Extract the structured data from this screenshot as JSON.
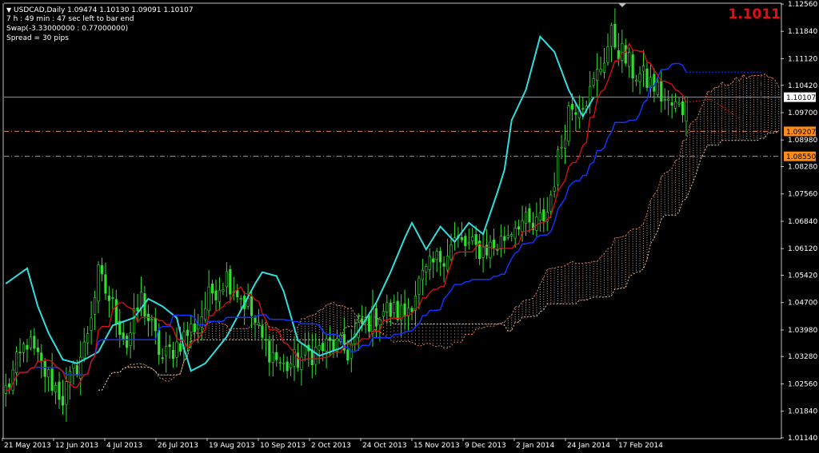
{
  "header": {
    "symbol_line": "USDCAD,Daily  1.09474 1.10130 1.09091 1.10107",
    "timer": "7 h : 49 min : 47 sec left to bar end",
    "swap": "Swap(-3.33000000 : 0.77000000)",
    "spread": "Spread = 30 pips",
    "big_price": "1.1011"
  },
  "colors": {
    "background": "#000000",
    "candles": "#33dd33",
    "tenkan": "#dd1111",
    "kijun": "#1133ff",
    "chikou": "#33dddd",
    "cloud": "#f2c4a8",
    "bid_line": "#8a93c8",
    "level_lines": "#e0825a",
    "level_label_bg": "#ff8c1a"
  },
  "chart_data": {
    "type": "candlestick",
    "symbol": "USDCAD",
    "timeframe": "Daily",
    "ohlc_last": {
      "open": 1.09474,
      "high": 1.1013,
      "low": 1.09091,
      "close": 1.10107
    },
    "ylim": [
      1.0114,
      1.1256
    ],
    "y_ticks": [
      "1.12560",
      "1.11840",
      "1.11120",
      "1.10420",
      "1.09700",
      "1.08980",
      "1.08280",
      "1.07560",
      "1.06840",
      "1.06120",
      "1.05420",
      "1.04700",
      "1.03980",
      "1.03280",
      "1.02560",
      "1.01840",
      "1.01140"
    ],
    "x_ticks": [
      "21 May 2013",
      "12 Jun 2013",
      "4 Jul 2013",
      "26 Jul 2013",
      "19 Aug 2013",
      "10 Sep 2013",
      "2 Oct 2013",
      "24 Oct 2013",
      "15 Nov 2013",
      "9 Dec 2013",
      "2 Jan 2014",
      "24 Jan 2014",
      "17 Feb 2014"
    ],
    "bars": 192,
    "shift_bars": 26,
    "bid_price": "1.10107",
    "levels": [
      "1.09207",
      "1.08550"
    ],
    "close_anchors": [
      [
        0,
        1.024
      ],
      [
        6,
        1.037
      ],
      [
        10,
        1.03
      ],
      [
        16,
        1.022
      ],
      [
        22,
        1.035
      ],
      [
        26,
        1.054
      ],
      [
        30,
        1.046
      ],
      [
        34,
        1.036
      ],
      [
        38,
        1.048
      ],
      [
        44,
        1.032
      ],
      [
        48,
        1.036
      ],
      [
        54,
        1.042
      ],
      [
        58,
        1.05
      ],
      [
        62,
        1.054
      ],
      [
        68,
        1.046
      ],
      [
        72,
        1.037
      ],
      [
        78,
        1.03
      ],
      [
        86,
        1.034
      ],
      [
        92,
        1.036
      ],
      [
        96,
        1.034
      ],
      [
        100,
        1.041
      ],
      [
        106,
        1.045
      ],
      [
        112,
        1.044
      ],
      [
        116,
        1.052
      ],
      [
        120,
        1.057
      ],
      [
        126,
        1.063
      ],
      [
        132,
        1.061
      ],
      [
        138,
        1.062
      ],
      [
        144,
        1.069
      ],
      [
        148,
        1.066
      ],
      [
        152,
        1.071
      ],
      [
        158,
        1.098
      ],
      [
        164,
        1.102
      ],
      [
        170,
        1.117
      ],
      [
        176,
        1.108
      ],
      [
        182,
        1.104
      ],
      [
        186,
        1.099
      ],
      [
        190,
        1.098
      ],
      [
        191,
        1.101
      ]
    ],
    "chikou_anchors": [
      [
        0,
        1.052
      ],
      [
        6,
        1.056
      ],
      [
        9,
        1.046
      ],
      [
        12,
        1.039
      ],
      [
        16,
        1.032
      ],
      [
        20,
        1.031
      ],
      [
        26,
        1.034
      ],
      [
        30,
        1.041
      ],
      [
        36,
        1.043
      ],
      [
        40,
        1.048
      ],
      [
        44,
        1.046
      ],
      [
        48,
        1.043
      ],
      [
        50,
        1.035
      ],
      [
        52,
        1.029
      ],
      [
        56,
        1.031
      ],
      [
        62,
        1.038
      ],
      [
        66,
        1.045
      ],
      [
        70,
        1.052
      ],
      [
        72,
        1.055
      ],
      [
        76,
        1.054
      ],
      [
        78,
        1.05
      ],
      [
        82,
        1.037
      ],
      [
        88,
        1.033
      ],
      [
        94,
        1.035
      ],
      [
        98,
        1.038
      ],
      [
        104,
        1.047
      ],
      [
        108,
        1.055
      ],
      [
        112,
        1.064
      ],
      [
        114,
        1.068
      ],
      [
        118,
        1.061
      ],
      [
        122,
        1.067
      ],
      [
        126,
        1.063
      ],
      [
        130,
        1.068
      ],
      [
        134,
        1.065
      ],
      [
        138,
        1.076
      ],
      [
        140,
        1.082
      ],
      [
        142,
        1.095
      ],
      [
        146,
        1.103
      ],
      [
        150,
        1.117
      ],
      [
        154,
        1.113
      ],
      [
        158,
        1.103
      ],
      [
        162,
        1.096
      ],
      [
        165,
        1.101
      ]
    ]
  }
}
